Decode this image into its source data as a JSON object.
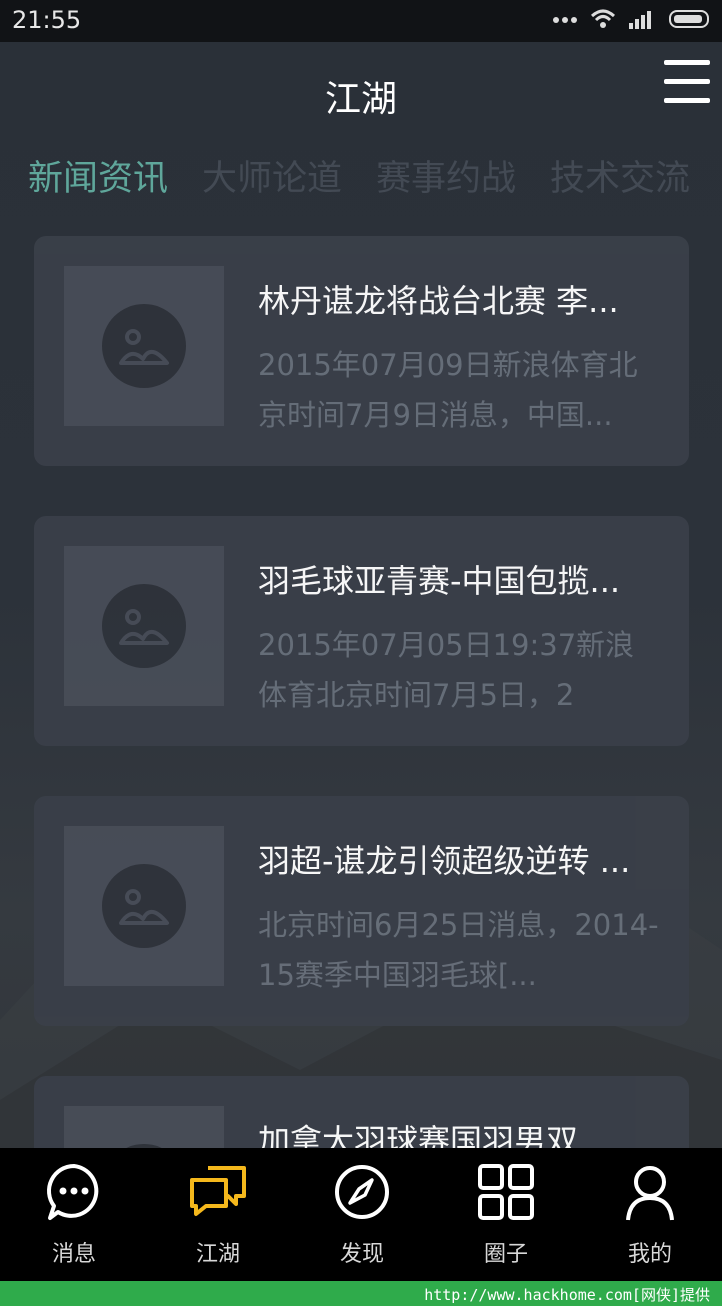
{
  "status_bar": {
    "time": "21:55",
    "icons": [
      "dots-icon",
      "wifi-icon",
      "signal-icon",
      "battery-icon"
    ]
  },
  "header": {
    "title": "江湖",
    "menu_icon": "hamburger-menu-icon"
  },
  "tabs": [
    {
      "label": "新闻资讯",
      "active": true
    },
    {
      "label": "大师论道",
      "active": false
    },
    {
      "label": "赛事约战",
      "active": false
    },
    {
      "label": "技术交流",
      "active": false
    }
  ],
  "articles": [
    {
      "title": "林丹谌龙将战台北赛 李...",
      "desc": "2015年07月09日新浪体育北京时间7月9日消息，中国...",
      "thumb_icon": "image-placeholder-icon"
    },
    {
      "title": "羽毛球亚青赛-中国包揽...",
      "desc": "2015年07月05日19:37新浪体育北京时间7月5日，2",
      "thumb_icon": "image-placeholder-icon"
    },
    {
      "title": "羽超-谌龙引领超级逆转 ...",
      "desc": "北京时间6月25日消息，2014-15赛季中国羽毛球[...",
      "thumb_icon": "image-placeholder-icon"
    },
    {
      "title": "加拿大羽球赛国羽男双...",
      "desc": "",
      "thumb_icon": "image-placeholder-icon"
    }
  ],
  "bottom_nav": [
    {
      "label": "消息",
      "icon": "chat-bubble-icon",
      "active": false
    },
    {
      "label": "江湖",
      "icon": "chat-bubbles-icon",
      "active": true
    },
    {
      "label": "发现",
      "icon": "compass-icon",
      "active": false
    },
    {
      "label": "圈子",
      "icon": "grid-icon",
      "active": false
    },
    {
      "label": "我的",
      "icon": "person-icon",
      "active": false
    }
  ],
  "colors": {
    "active_tab": "#5fa79b",
    "active_nav_icon": "#f5b81c",
    "footer_bar": "#2fab4b"
  },
  "watermark": {
    "text": "http://www.hackhome.com[网侠]提供"
  }
}
